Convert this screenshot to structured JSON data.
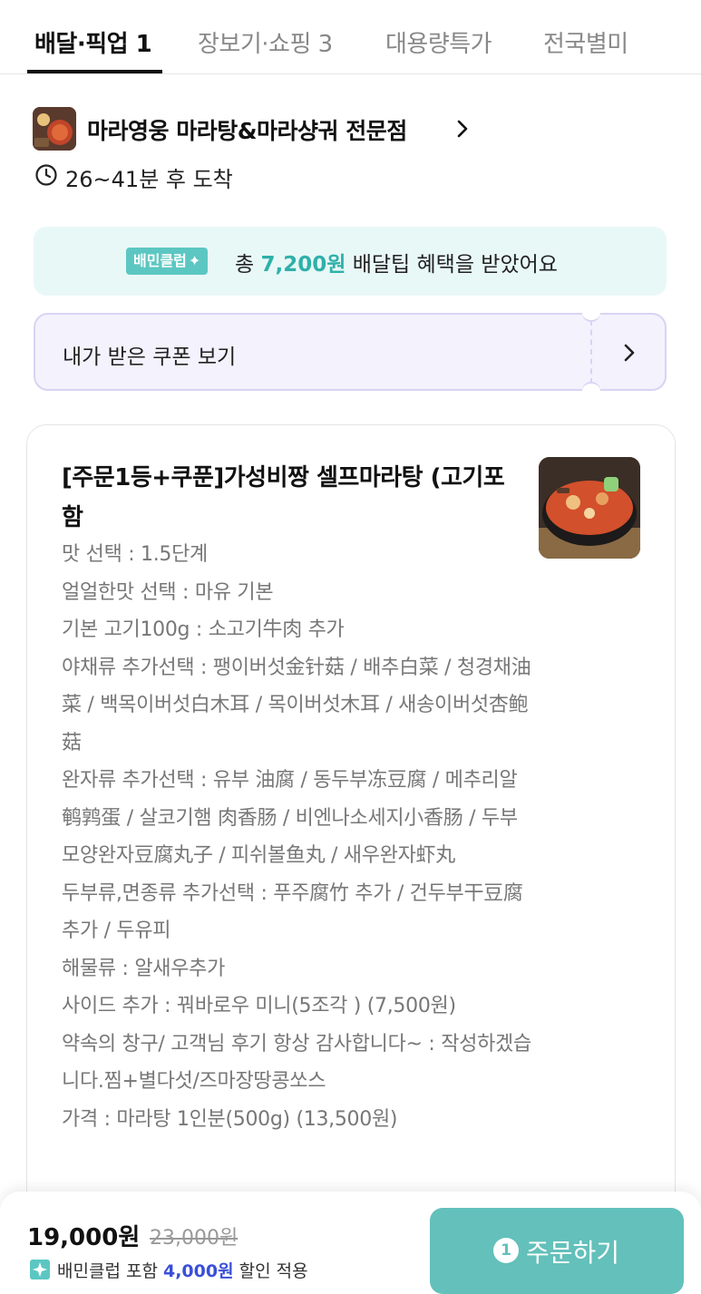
{
  "tabs": [
    {
      "label": "배달·픽업 1",
      "active": true
    },
    {
      "label": "장보기·쇼핑 3",
      "active": false
    },
    {
      "label": "대용량특가",
      "active": false
    },
    {
      "label": "전국별미",
      "active": false
    }
  ],
  "store": {
    "name": "마라영웅 마라탕&마라샹궈 전문점",
    "eta": "26~41분 후 도착"
  },
  "benefit": {
    "badge": "배민클럽",
    "prefix": "총",
    "amount": "7,200원",
    "suffix": "배달팁 혜택을 받았어요"
  },
  "coupon": {
    "label": "내가 받은 쿠폰 보기"
  },
  "order_item": {
    "title": "[주문1등+쿠푼]가성비짱 셀프마라탕 (고기포함",
    "options": [
      "맛 선택 : 1.5단계",
      "얼얼한맛 선택 : 마유 기본",
      "기본 고기100g : 소고기牛肉 추가",
      "야채류 추가선택 : 팽이버섯金针菇 / 배추白菜 / 청경채油菜 / 백목이버섯白木耳 / 목이버섯木耳 / 새송이버섯杏鲍菇",
      "완자류 추가선택 : 유부 油腐 / 동두부冻豆腐 / 메추리알鹌鹑蛋 / 살코기햄 肉香肠 / 비엔나소세지小香肠 / 두부모양완자豆腐丸子 / 피쉬볼鱼丸 / 새우완자虾丸",
      "두부류,면종류 추가선택 : 푸주腐竹 추가 / 건두부干豆腐 추가 / 두유피",
      "해물류 : 알새우추가",
      "사이드 추가 : 꿔바로우 미니(5조각 ) (7,500원)",
      "약속의 창구/ 고객님 후기 항상 감사합니다~ : 작성하겠습니다.찜+별다섯/즈마장땅콩쏘스",
      "가격 : 마라탕 1인분(500g) (13,500원)"
    ]
  },
  "bottom": {
    "price": "19,000원",
    "original_price": "23,000원",
    "discount_prefix": "배민클럽 포함",
    "discount_amount": "4,000원",
    "discount_suffix": "할인 적용",
    "order_count": "1",
    "order_label": "주문하기"
  },
  "colors": {
    "mint": "#5cc7c2",
    "mint_text": "#2fb0aa",
    "order_button": "#63c0ba",
    "discount_blue": "#3a4fd8",
    "coupon_bg": "#f4f2fd"
  }
}
